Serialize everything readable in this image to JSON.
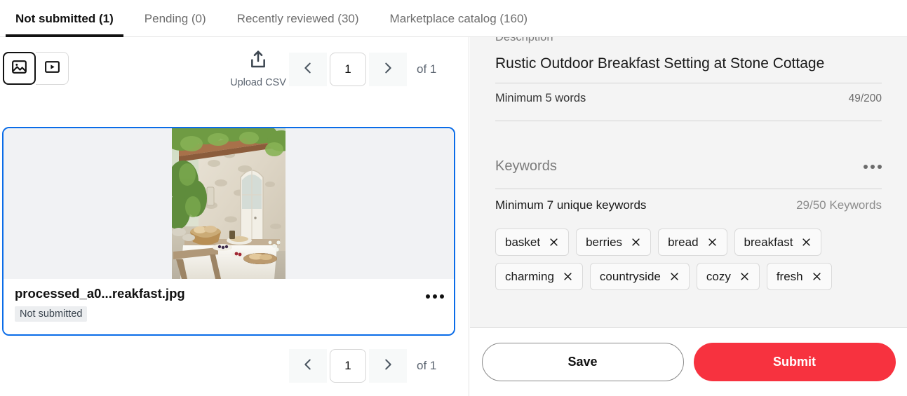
{
  "tabs": [
    {
      "label": "Not submitted (1)",
      "active": true
    },
    {
      "label": "Pending (0)",
      "active": false
    },
    {
      "label": "Recently reviewed (30)",
      "active": false
    },
    {
      "label": "Marketplace catalog (160)",
      "active": false
    }
  ],
  "toolbar": {
    "media_image_icon": "image-icon",
    "media_video_icon": "video-icon",
    "upload_icon": "upload-icon",
    "upload_label": "Upload CSV"
  },
  "pagination_top": {
    "prev_icon": "chevron-left-icon",
    "next_icon": "chevron-right-icon",
    "page": "1",
    "of_label": "of 1"
  },
  "pagination_bottom": {
    "prev_icon": "chevron-left-icon",
    "next_icon": "chevron-right-icon",
    "page": "1",
    "of_label": "of 1"
  },
  "asset": {
    "filename": "processed_a0...reakfast.jpg",
    "status": "Not submitted",
    "menu_icon": "more-options-icon",
    "selected_border_color": "#0a6ce8"
  },
  "details": {
    "description_label": "Description",
    "description_value": "Rustic Outdoor Breakfast Setting at Stone Cottage",
    "description_help": "Minimum 5 words",
    "description_count": "49/200",
    "keywords_title": "Keywords",
    "keywords_menu_icon": "more-options-icon",
    "keywords_help": "Minimum 7 unique keywords",
    "keywords_count": "29/50 Keywords",
    "keywords": [
      "basket",
      "berries",
      "bread",
      "breakfast",
      "charming",
      "countryside",
      "cozy",
      "fresh"
    ]
  },
  "actions": {
    "save_label": "Save",
    "submit_label": "Submit",
    "submit_color": "#f7323f"
  }
}
